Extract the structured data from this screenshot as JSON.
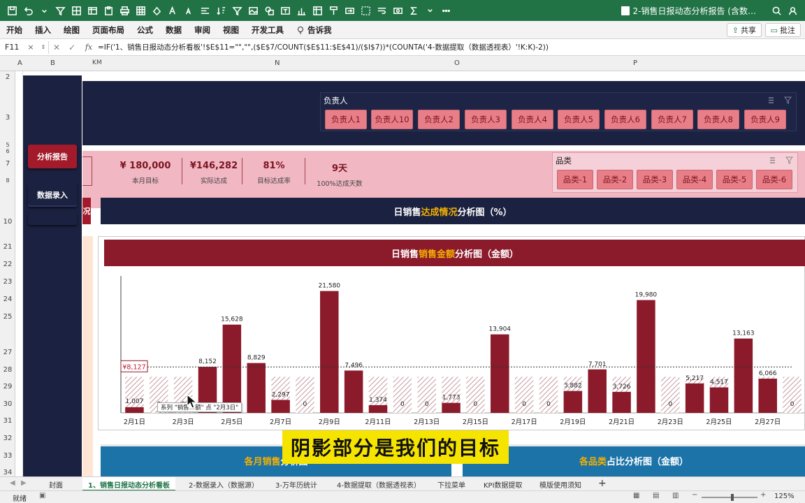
{
  "app": {
    "title": "2-销售日报动态分析报告 (含数…",
    "accent": "#217346"
  },
  "ribbon": {
    "tabs": [
      "开始",
      "插入",
      "绘图",
      "页面布局",
      "公式",
      "数据",
      "审阅",
      "视图",
      "开发工具"
    ],
    "tell_me": "告诉我",
    "share": "共享",
    "comment": "批注"
  },
  "formula_bar": {
    "cell_ref": "F11",
    "formula": "=IF('1、销售日报动态分析看板'!$E$11=\"\",\"\",($E$7/COUNT($E$11:$E$41)/($I$7))*(COUNTA('4-数据提取（数据透视表）'!K:K)-2))"
  },
  "columns": [
    "A",
    "B",
    "K",
    "M",
    "N",
    "O",
    "P"
  ],
  "rows": [
    "2",
    "3",
    "5",
    "6",
    "7",
    "8",
    "10",
    "21",
    "22",
    "23",
    "24",
    "25",
    "27",
    "28",
    "29",
    "30",
    "31",
    "32",
    "33",
    "34"
  ],
  "sidebar": {
    "buttons": [
      {
        "label": "分析报告"
      },
      {
        "label": "数据录入"
      }
    ]
  },
  "slicer_person": {
    "title": "负责人",
    "items": [
      "负责人1",
      "负责人10",
      "负责人2",
      "负责人3",
      "负责人4",
      "负责人5",
      "负责人6",
      "负责人7",
      "负责人8",
      "负责人9"
    ]
  },
  "kpis": [
    {
      "value": "¥  180,000",
      "label": "本月目标"
    },
    {
      "value": "¥146,282",
      "label": "实际达成"
    },
    {
      "value": "81%",
      "label": "目标达成率"
    },
    {
      "value": "9天",
      "label": "100%达成天数"
    }
  ],
  "slicer_category": {
    "title": "品类",
    "items": [
      "品类-1",
      "品类-2",
      "品类-3",
      "品类-4",
      "品类-5",
      "品类-6"
    ]
  },
  "sections": {
    "achievement": {
      "pre": "日销售",
      "hl": "达成情况",
      "post": "分析图（%）"
    },
    "amount": {
      "pre": "日销售",
      "hl": "销售金额",
      "post": "分析图（金额）"
    },
    "monthly": {
      "hl": "各月销售",
      "post": "分析图"
    },
    "category_share": {
      "hl": "各品类",
      "post": "占比分析图（金额）"
    },
    "left_cut": "况"
  },
  "chart_data": {
    "type": "bar",
    "title": "日销售销售金额分析图（金额）",
    "categories": [
      "2月1日",
      "2月2日",
      "2月3日",
      "2月4日",
      "2月5日",
      "2月6日",
      "2月7日",
      "2月8日",
      "2月9日",
      "2月10日",
      "2月11日",
      "2月12日",
      "2月13日",
      "2月14日",
      "2月15日",
      "2月16日",
      "2月17日",
      "2月18日",
      "2月19日",
      "2月20日",
      "2月21日",
      "2月22日",
      "2月23日",
      "2月24日",
      "2月25日",
      "2月26日",
      "2月27日",
      "2月28日"
    ],
    "tick_labels_shown": [
      "2月1日",
      "2月3日",
      "2月5日",
      "2月7日",
      "2月9日",
      "2月11日",
      "2月13日",
      "2月15日",
      "2月17日",
      "2月19日",
      "2月21日",
      "2月23日",
      "2月25日",
      "2月27日"
    ],
    "series": [
      {
        "values": [
          1007,
          0,
          0,
          8152,
          15628,
          8829,
          2297,
          0,
          21580,
          7496,
          1374,
          0,
          0,
          1773,
          0,
          13904,
          0,
          0,
          3882,
          7701,
          3726,
          19980,
          0,
          5217,
          4517,
          13163,
          6066,
          0
        ]
      }
    ],
    "data_labels": [
      "1,007",
      "0",
      "0",
      "8,152",
      "15,628",
      "8,829",
      "2,297",
      "0",
      "21,580",
      "7,496",
      "1,374",
      "0",
      "0",
      "1,773",
      "0",
      "13,904",
      "0",
      "0",
      "3,882",
      "7,701",
      "3,726",
      "19,980",
      "0",
      "5,217",
      "4,517",
      "13,163",
      "6,066",
      "0"
    ],
    "target_line": {
      "value": 8127,
      "label": "¥8,127"
    },
    "ylim": [
      0,
      24000
    ],
    "bar_color": "#8b1a2b",
    "target_fill": "hatched",
    "grid": false
  },
  "tooltip": {
    "text": "系列 \"销售…额\" 点 \"2月3日\""
  },
  "caption": "阴影部分是我们的目标",
  "sheet_tabs": [
    "封面",
    "1、销售日报动态分析看板",
    "2-数据录入（数据源）",
    "3-万年历统计",
    "4-数据提取（数据透视表）",
    "下拉菜单",
    "KPI数据提取",
    "模版使用须知"
  ],
  "status": {
    "ready": "就绪",
    "zoom": "125%",
    "zoom_level": 0.55
  }
}
